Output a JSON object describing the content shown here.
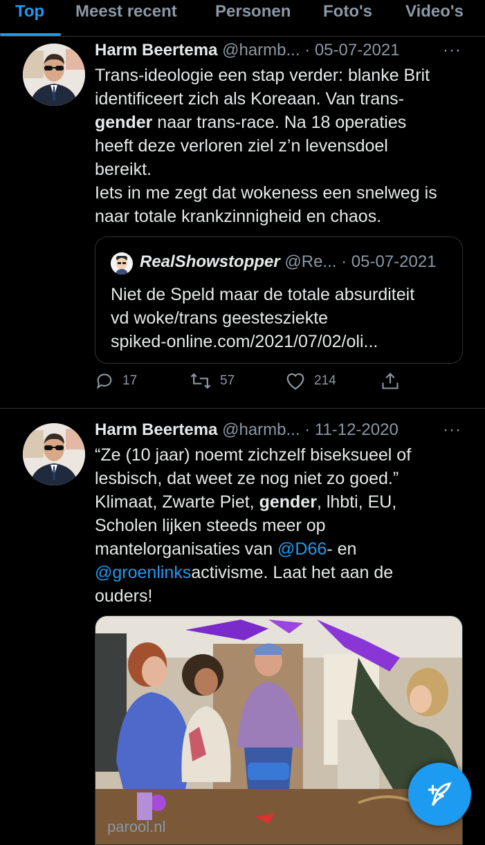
{
  "tabs": [
    {
      "label": "Top"
    },
    {
      "label": "Meest recent"
    },
    {
      "label": "Personen"
    },
    {
      "label": "Foto's"
    },
    {
      "label": "Video's"
    }
  ],
  "tweets": [
    {
      "name": "Harm Beertema",
      "handle": "@harmb...",
      "date": "· 05-07-2021",
      "more": "···",
      "lines": [
        {
          "a": "Trans-ideologie een stap verder: blanke Brit"
        },
        {
          "a": "identificeert zich als Koreaan. Van trans-"
        },
        {
          "bold": "gender",
          "b": " naar trans-race. Na 18 operaties"
        },
        {
          "a": "heeft deze verloren ziel z’n levensdoel"
        },
        {
          "a": "bereikt."
        },
        {
          "a": "Iets in me zegt dat wokeness een snelweg is"
        },
        {
          "a": "naar totale krankzinnigheid en chaos."
        }
      ],
      "quote": {
        "name": "RealShowstopper",
        "handle": "@Re...",
        "date": "· 05-07-2021",
        "lines": [
          "Niet de Speld maar de totale absurditeit",
          "vd woke/trans geestesziekte",
          "spiked-online.com/2021/07/02/oli..."
        ]
      },
      "actions": {
        "replies": "17",
        "retweets": "57",
        "likes": "214"
      }
    },
    {
      "name": "Harm Beertema",
      "handle": "@harmb...",
      "date": "· 11-12-2020",
      "more": "···",
      "lines": [
        {
          "a": "“Ze (10 jaar) noemt zichzelf biseksueel of"
        },
        {
          "a": "lesbisch, dat weet ze nog niet zo goed.”"
        },
        {
          "a": "Klimaat, Zwarte Piet, ",
          "bold": "gender",
          "b": ", lhbti, EU,"
        },
        {
          "a": "Scholen lijken steeds meer op"
        },
        {
          "a": "mantelorganisaties van ",
          "link": "@D66",
          "b": "- en"
        },
        {
          "link": "@groenlinks",
          "b": "activisme. Laat het aan de"
        },
        {
          "a": "ouders!"
        }
      ],
      "media_caption": "parool.nl"
    }
  ],
  "colors": {
    "accent": "#1d9bf0",
    "muted": "#8b98a5",
    "text": "#e7e9ea",
    "border": "#2f3336",
    "background": "#000000"
  }
}
